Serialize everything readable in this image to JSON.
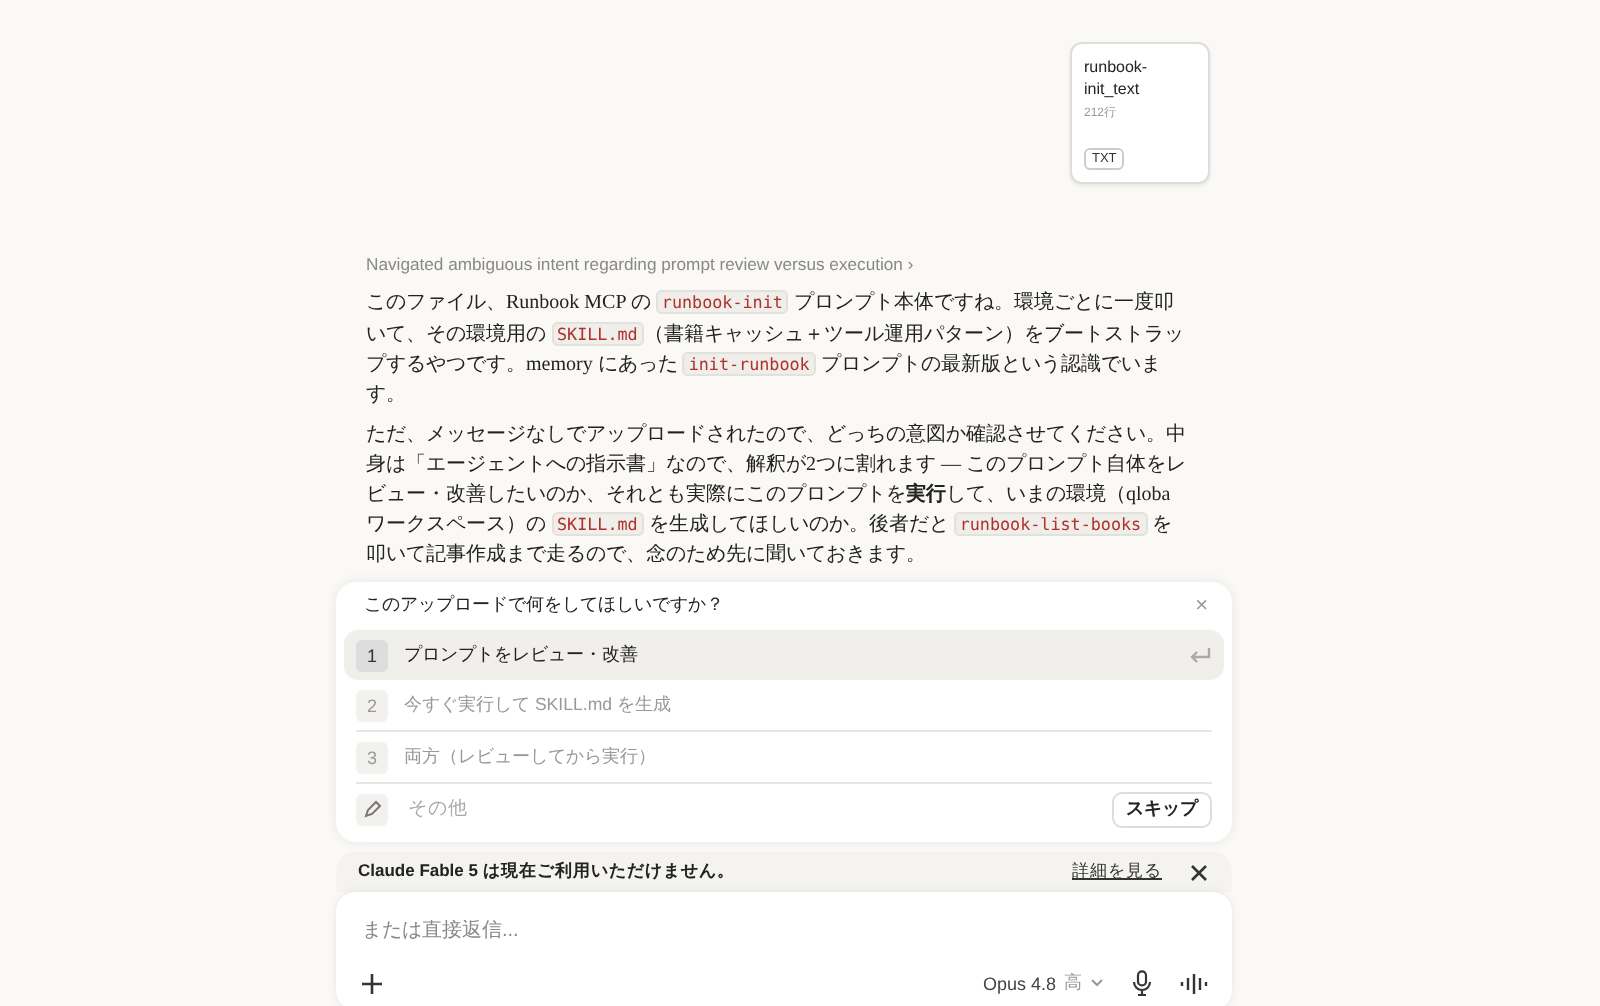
{
  "attachment": {
    "name": "runbook-init_text",
    "meta": "212行",
    "type": "TXT"
  },
  "thinking_summary": {
    "label": "Navigated ambiguous intent regarding prompt review versus execution",
    "chevron": "›"
  },
  "message": {
    "paragraphs": [
      [
        {
          "kind": "text",
          "text": "このファイル、Runbook MCP の "
        },
        {
          "kind": "code",
          "text": "runbook-init"
        },
        {
          "kind": "text",
          "text": " プロンプト本体ですね。環境ごとに一度叩いて、その環境用の "
        },
        {
          "kind": "code",
          "text": "SKILL.md"
        },
        {
          "kind": "text",
          "text": "（書籍キャッシュ＋ツール運用パターン）をブートストラップするやつです。memory にあった "
        },
        {
          "kind": "code",
          "text": "init-runbook"
        },
        {
          "kind": "text",
          "text": " プロンプトの最新版という認識でいます。"
        }
      ],
      [
        {
          "kind": "text",
          "text": "ただ、メッセージなしでアップロードされたので、どっちの意図か確認させてください。中身は「エージェントへの指示書」なので、解釈が2つに割れます — このプロンプト自体をレビュー・改善したいのか、それとも実際にこのプロンプトを**実行**して、いまの環境（qloba ワークスペース）の "
        },
        {
          "kind": "code",
          "text": "SKILL.md"
        },
        {
          "kind": "text",
          "text": " を生成してほしいのか。後者だと "
        },
        {
          "kind": "code",
          "text": "runbook-list-books"
        },
        {
          "kind": "text",
          "text": " を叩いて記事作成まで走るので、念のため先に聞いておきます。"
        }
      ]
    ]
  },
  "question": {
    "title": "このアップロードで何をしてほしいですか？",
    "close": "×",
    "options": [
      {
        "number": "1",
        "label": "プロンプトをレビュー・改善",
        "selected": true
      },
      {
        "number": "2",
        "label": "今すぐ実行して SKILL.md を生成",
        "selected": false
      },
      {
        "number": "3",
        "label": "両方（レビューしてから実行）",
        "selected": false
      }
    ],
    "other": {
      "placeholder": "その他"
    },
    "skip": "スキップ"
  },
  "banner": {
    "text": "Claude Fable 5 は現在ご利用いただけません。",
    "link": "詳細を見る"
  },
  "composer": {
    "placeholder": "または直接返信...",
    "model": "Opus 4.8",
    "effort": "高"
  }
}
